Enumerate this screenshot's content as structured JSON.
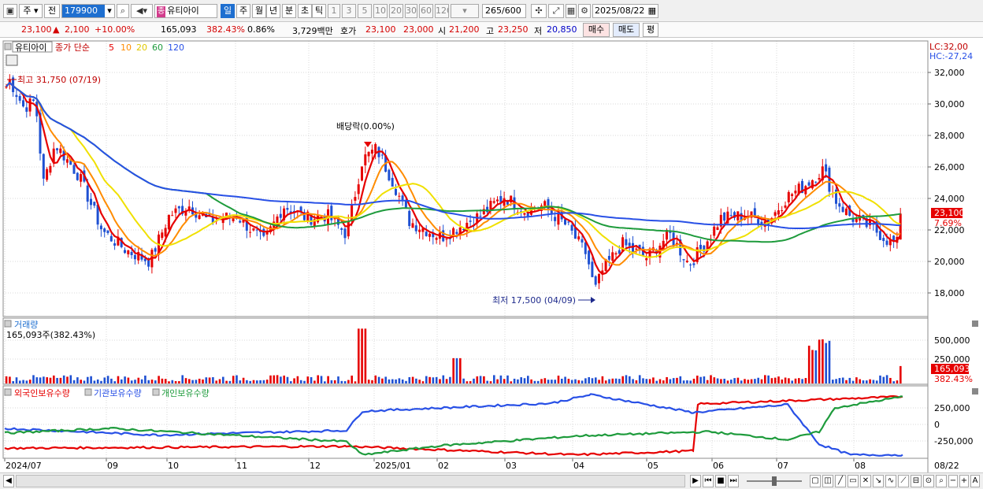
{
  "toolbar": {
    "period_selector": "주",
    "prev_button": "전",
    "stock_code": "179900",
    "stock_type_tag": "종",
    "stock_name": "유티아이",
    "timeframes": [
      "일",
      "주",
      "월",
      "년",
      "분",
      "초",
      "틱"
    ],
    "minute_intervals": [
      "1",
      "3",
      "5",
      "10",
      "20",
      "30",
      "60",
      "120"
    ],
    "data_count": "265",
    "data_total": "/600",
    "date": "2025/08/22"
  },
  "quote": {
    "price": "23,100",
    "change": "2,100",
    "change_pct": "+10.00%",
    "volume": "165,093",
    "volume_ratio": "382.43%",
    "turnover": "0.86%",
    "trade_value": "3,729백만",
    "ask_label": "호가",
    "ask1": "23,100",
    "ask2": "23,000",
    "open_label": "시",
    "open": "21,200",
    "high_label": "고",
    "high": "23,250",
    "low_label": "저",
    "low": "20,850",
    "buy_label": "매수",
    "sell_label": "매도",
    "eval_label": "평"
  },
  "price_panel": {
    "legend_name": "유티아이",
    "legend_ma": "종가 단순",
    "ma_periods": [
      "5",
      "10",
      "20",
      "60",
      "120"
    ],
    "ma_colors": [
      "#e60000",
      "#ff8c00",
      "#f0e000",
      "#1e9b3c",
      "#2850e6"
    ],
    "max_label": "최고 31,750 (07/19)",
    "min_label": "최저 17,500 (04/09)",
    "dividend_label": "배당락(0.00%)",
    "lc_label": "LC:32,00",
    "hc_label": "HC:-27,24",
    "price_tag": "23,100",
    "price_pct_tag": "7.69%",
    "y_ticks": [
      "32,000",
      "30,000",
      "28,000",
      "26,000",
      "24,000",
      "22,000",
      "20,000",
      "18,000"
    ]
  },
  "volume_panel": {
    "title": "거래량",
    "value_label": "165,093주(382.43%)",
    "y_ticks": [
      "500,000",
      "250,000"
    ],
    "tag": "165,093",
    "tag_pct": "382.43%"
  },
  "holding_panel": {
    "series": [
      "외국인보유수량",
      "기관보유수량",
      "개인보유수량"
    ],
    "colors": [
      "#e60000",
      "#2850e6",
      "#1e9b3c"
    ],
    "y_ticks": [
      "250,000",
      "0",
      "-250,000"
    ]
  },
  "x_axis": {
    "labels": [
      "2024/07",
      "09",
      "10",
      "11",
      "12",
      "2025/01",
      "02",
      "03",
      "04",
      "05",
      "06",
      "07",
      "08"
    ],
    "right_label": "08/22"
  },
  "chart_data": {
    "type": "line",
    "title": "유티아이",
    "x_label_dates": [
      "2024/07",
      "09",
      "10",
      "11",
      "12",
      "2025/01",
      "02",
      "03",
      "04",
      "05",
      "06",
      "07",
      "08"
    ],
    "ylim": [
      17000,
      33000
    ],
    "price_close_approx": [
      [
        "2024/07",
        30500
      ],
      [
        "2024/07/19",
        31750
      ],
      [
        "2024/08",
        27500
      ],
      [
        "2024/09",
        20500
      ],
      [
        "2024/10",
        23500
      ],
      [
        "2024/11",
        22000
      ],
      [
        "2024/12",
        22800
      ],
      [
        "2024/12/26",
        27000
      ],
      [
        "2025/01",
        24000
      ],
      [
        "2025/02",
        21500
      ],
      [
        "2025/03",
        23500
      ],
      [
        "2025/04",
        20000
      ],
      [
        "2025/04/09",
        17500
      ],
      [
        "2025/05",
        21000
      ],
      [
        "2025/06",
        22500
      ],
      [
        "2025/07",
        24500
      ],
      [
        "2025/07/20",
        26000
      ],
      [
        "2025/08",
        22000
      ],
      [
        "2025/08/22",
        23100
      ]
    ],
    "last": {
      "open": 21200,
      "high": 23250,
      "low": 20850,
      "close": 23100,
      "change": 2100,
      "change_pct": 10.0,
      "volume": 165093
    },
    "max": {
      "date": "07/19",
      "value": 31750
    },
    "min": {
      "date": "04/09",
      "value": 17500
    }
  }
}
